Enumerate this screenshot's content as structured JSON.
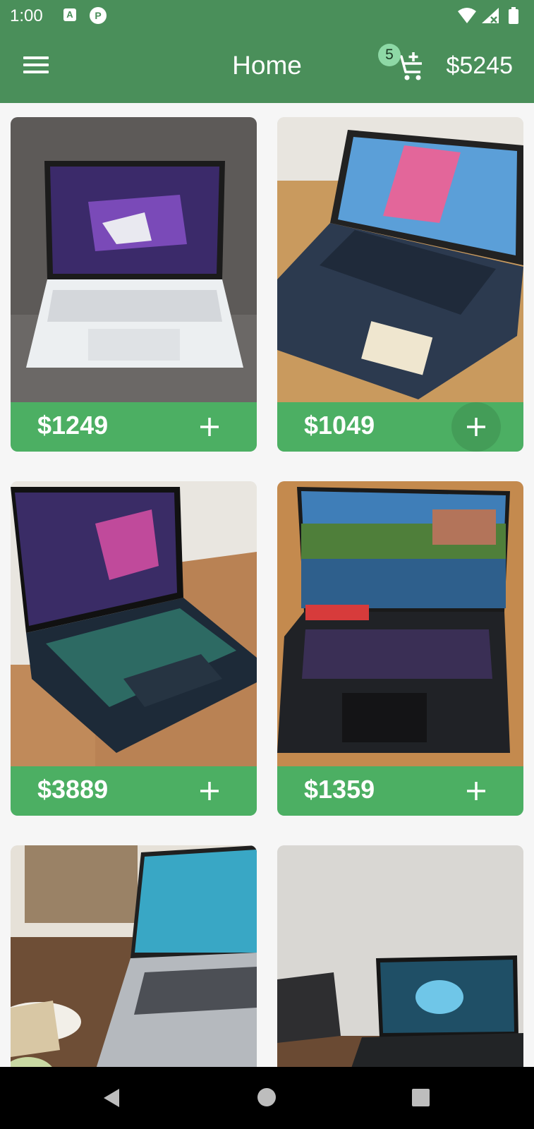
{
  "status_bar": {
    "time": "1:00",
    "app_icon_a": "A",
    "app_icon_p": "P",
    "icons": [
      "wifi-icon",
      "signal-icon",
      "battery-icon"
    ]
  },
  "app_bar": {
    "title": "Home",
    "cart_badge_count": "5",
    "cart_total": "$5245",
    "icons": [
      "menu-icon",
      "add-shopping-cart-icon"
    ],
    "color": "#4a8f5a"
  },
  "products": [
    {
      "price": "$1249",
      "add_icon": "plus-icon"
    },
    {
      "price": "$1049",
      "add_icon": "plus-icon"
    },
    {
      "price": "$3889",
      "add_icon": "plus-icon"
    },
    {
      "price": "$1359",
      "add_icon": "plus-icon"
    },
    {
      "price": "",
      "add_icon": "plus-icon"
    },
    {
      "price": "",
      "add_icon": "plus-icon"
    }
  ],
  "colors": {
    "card_footer": "#4caf63",
    "badge": "#8ed9a6",
    "background": "#f6f6f6"
  },
  "nav_bar": {
    "icons": [
      "back-icon",
      "home-icon",
      "recents-icon"
    ]
  }
}
